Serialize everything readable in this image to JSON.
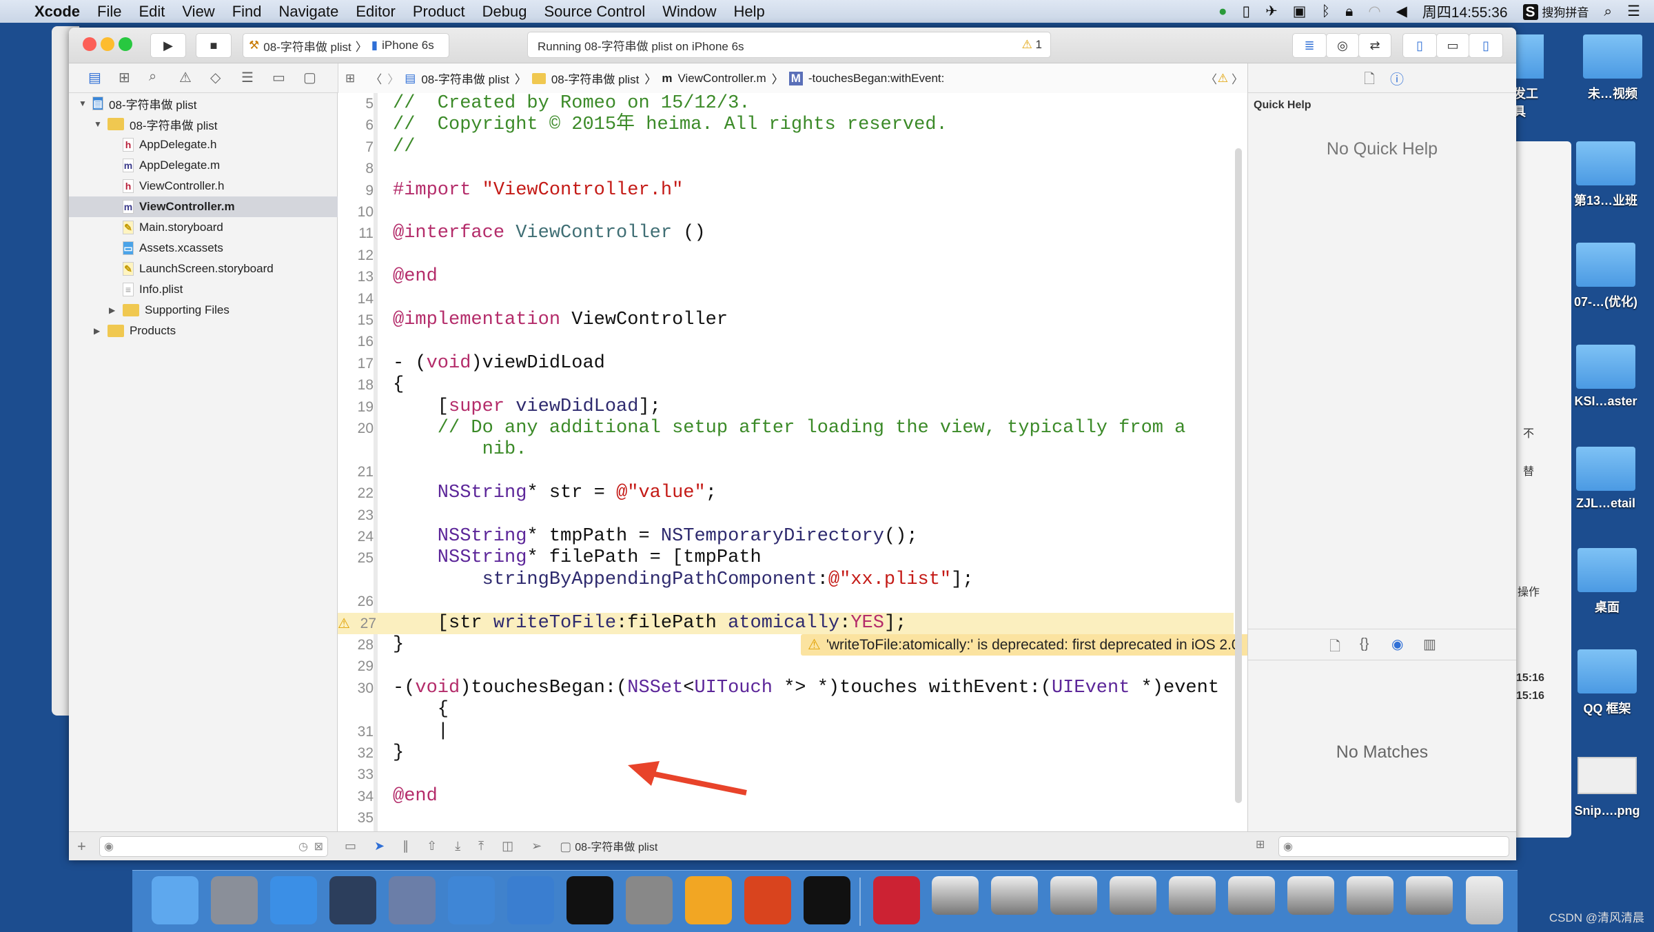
{
  "menubar": {
    "app": "Xcode",
    "items": [
      "File",
      "Edit",
      "View",
      "Find",
      "Navigate",
      "Editor",
      "Product",
      "Debug",
      "Source Control",
      "Window",
      "Help"
    ],
    "clock": "周四14:55:36",
    "ime": "搜狗拼音"
  },
  "toolbar": {
    "scheme": "08-字符串做 plist",
    "device": "iPhone 6s",
    "activity": "Running 08-字符串做 plist on iPhone 6s",
    "warning_count": "1"
  },
  "jumpbar": {
    "items": [
      "08-字符串做 plist",
      "08-字符串做 plist",
      "ViewController.m",
      "-touchesBegan:withEvent:"
    ]
  },
  "navigator": {
    "items": [
      {
        "label": "08-字符串做 plist",
        "icon": "project",
        "depth": 0,
        "disclosure": "open"
      },
      {
        "label": "08-字符串做 plist",
        "icon": "folder",
        "depth": 1,
        "disclosure": "open"
      },
      {
        "label": "AppDelegate.h",
        "icon": "h",
        "depth": 2
      },
      {
        "label": "AppDelegate.m",
        "icon": "m",
        "depth": 2
      },
      {
        "label": "ViewController.h",
        "icon": "h",
        "depth": 2
      },
      {
        "label": "ViewController.m",
        "icon": "m",
        "depth": 2,
        "selected": true
      },
      {
        "label": "Main.storyboard",
        "icon": "storyboard",
        "depth": 2
      },
      {
        "label": "Assets.xcassets",
        "icon": "assets",
        "depth": 2
      },
      {
        "label": "LaunchScreen.storyboard",
        "icon": "storyboard",
        "depth": 2
      },
      {
        "label": "Info.plist",
        "icon": "plist",
        "depth": 2
      },
      {
        "label": "Supporting Files",
        "icon": "folder",
        "depth": 2,
        "disclosure": "closed"
      },
      {
        "label": "Products",
        "icon": "folder",
        "depth": 1,
        "disclosure": "closed"
      }
    ]
  },
  "editor": {
    "rows": [
      {
        "n": "5",
        "t": [
          [
            "comment",
            "//  Created by Romeo on 15/12/3."
          ]
        ]
      },
      {
        "n": "6",
        "t": [
          [
            "comment",
            "//  Copyright © 2015年 heima. All rights reserved."
          ]
        ]
      },
      {
        "n": "7",
        "t": [
          [
            "comment",
            "//"
          ]
        ]
      },
      {
        "n": "8",
        "t": []
      },
      {
        "n": "9",
        "t": [
          [
            "kw",
            "#import "
          ],
          [
            "str",
            "\"ViewController.h\""
          ]
        ]
      },
      {
        "n": "10",
        "t": []
      },
      {
        "n": "11",
        "t": [
          [
            "kw",
            "@interface "
          ],
          [
            "cls",
            "ViewController"
          ],
          [
            "plain",
            " ()"
          ]
        ]
      },
      {
        "n": "12",
        "t": []
      },
      {
        "n": "13",
        "t": [
          [
            "kw",
            "@end"
          ]
        ]
      },
      {
        "n": "14",
        "t": []
      },
      {
        "n": "15",
        "t": [
          [
            "kw",
            "@implementation "
          ],
          [
            "plain",
            "ViewController"
          ]
        ]
      },
      {
        "n": "16",
        "t": []
      },
      {
        "n": "17",
        "t": [
          [
            "plain",
            "- ("
          ],
          [
            "kw",
            "void"
          ],
          [
            "plain",
            ")viewDidLoad"
          ]
        ]
      },
      {
        "n": "18",
        "t": [
          [
            "plain",
            "{"
          ]
        ]
      },
      {
        "n": "19",
        "t": [
          [
            "plain",
            "    ["
          ],
          [
            "kw",
            "super"
          ],
          [
            "call",
            " viewDidLoad"
          ],
          [
            "plain",
            "];"
          ]
        ]
      },
      {
        "n": "20",
        "t": [
          [
            "comment",
            "    // Do any additional setup after loading the view, typically from a"
          ]
        ]
      },
      {
        "n": "",
        "t": [
          [
            "comment",
            "        nib."
          ]
        ]
      },
      {
        "n": "21",
        "t": []
      },
      {
        "n": "22",
        "t": [
          [
            "type",
            "    NSString"
          ],
          [
            "plain",
            "* str = "
          ],
          [
            "str",
            "@\"value\""
          ],
          [
            "plain",
            ";"
          ]
        ]
      },
      {
        "n": "23",
        "t": []
      },
      {
        "n": "24",
        "t": [
          [
            "type",
            "    NSString"
          ],
          [
            "plain",
            "* tmpPath = "
          ],
          [
            "call",
            "NSTemporaryDirectory"
          ],
          [
            "plain",
            "();"
          ]
        ]
      },
      {
        "n": "25",
        "t": [
          [
            "type",
            "    NSString"
          ],
          [
            "plain",
            "* filePath = [tmpPath"
          ]
        ]
      },
      {
        "n": "",
        "t": [
          [
            "call",
            "        stringByAppendingPathComponent"
          ],
          [
            "plain",
            ":"
          ],
          [
            "str",
            "@\"xx.plist\""
          ],
          [
            "plain",
            "];"
          ]
        ]
      },
      {
        "n": "26",
        "t": []
      },
      {
        "n": "27",
        "t": [
          [
            "plain",
            "    [str "
          ],
          [
            "call",
            "writeToFile"
          ],
          [
            "plain",
            ":filePath "
          ],
          [
            "call",
            "atomically"
          ],
          [
            "plain",
            ":"
          ],
          [
            "kw",
            "YES"
          ],
          [
            "plain",
            "];"
          ]
        ],
        "highlight": true,
        "warning": true
      },
      {
        "n": "28",
        "t": [
          [
            "plain",
            "}"
          ]
        ]
      },
      {
        "n": "29",
        "t": []
      },
      {
        "n": "30",
        "t": [
          [
            "plain",
            "-("
          ],
          [
            "kw",
            "void"
          ],
          [
            "plain",
            ")touchesBegan:("
          ],
          [
            "type",
            "NSSet"
          ],
          [
            "plain",
            "<"
          ],
          [
            "type",
            "UITouch"
          ],
          [
            "plain",
            " *> *)touches withEvent:("
          ],
          [
            "type",
            "UIEvent"
          ],
          [
            "plain",
            " *)event"
          ]
        ]
      },
      {
        "n": "",
        "t": [
          [
            "plain",
            "    {"
          ]
        ]
      },
      {
        "n": "31",
        "t": [
          [
            "plain",
            "    |"
          ]
        ]
      },
      {
        "n": "32",
        "t": [
          [
            "plain",
            "}"
          ]
        ]
      },
      {
        "n": "33",
        "t": []
      },
      {
        "n": "34",
        "t": [
          [
            "kw",
            "@end"
          ]
        ]
      },
      {
        "n": "35",
        "t": []
      }
    ],
    "warning_message": "'writeToFile:atomically:' is deprecated: first deprecated in iOS 2.0"
  },
  "utility": {
    "quick_help_title": "Quick Help",
    "quick_help_empty": "No Quick Help",
    "library_empty": "No Matches"
  },
  "bottombar": {
    "target": "08-字符串做 plist"
  },
  "desktop": {
    "items": [
      "开发工具",
      "未…视频",
      "第13…业班",
      "07-…(优化)",
      "KSI…aster",
      "ZJL…etail",
      "桌面",
      "QQ 框架",
      "Snip….png"
    ],
    "background_fragments": [
      "不",
      "替",
      "操作",
      "15:16",
      "15:16"
    ]
  },
  "watermark": "CSDN @清风清晨",
  "colors": {
    "desktop": "#1c4d8f",
    "accent": "#2f6fd6",
    "warning": "#fbe3a0",
    "arrow": "#e8432a"
  }
}
